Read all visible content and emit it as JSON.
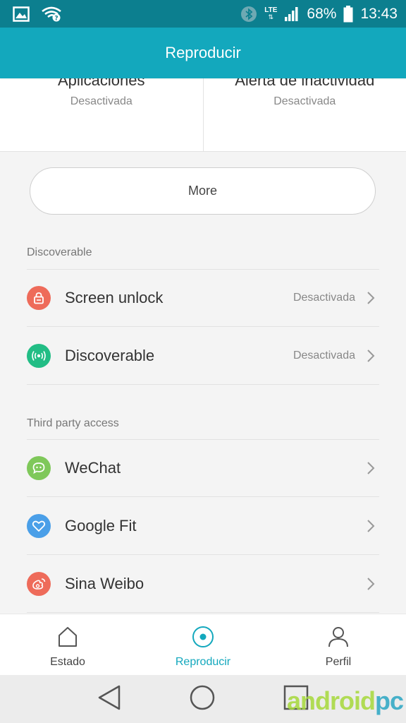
{
  "status_bar": {
    "network": "LTE",
    "battery": "68%",
    "time": "13:43"
  },
  "header": {
    "title": "Reproducir"
  },
  "top_cards": [
    {
      "title": "Aplicaciones",
      "value": "Desactivada"
    },
    {
      "title": "Alerta de inactividad",
      "value": "Desactivada"
    }
  ],
  "more_button": {
    "label": "More"
  },
  "sections": [
    {
      "header": "Discoverable",
      "items": [
        {
          "label": "Screen unlock",
          "value": "Desactivada",
          "icon": "lock-icon",
          "color": "#ee6b5a"
        },
        {
          "label": "Discoverable",
          "value": "Desactivada",
          "icon": "broadcast-icon",
          "color": "#22bd85"
        }
      ]
    },
    {
      "header": "Third party access",
      "items": [
        {
          "label": "WeChat",
          "icon": "wechat-icon",
          "color": "#7fc85a"
        },
        {
          "label": "Google Fit",
          "icon": "heart-icon",
          "color": "#4a9fe8"
        },
        {
          "label": "Sina Weibo",
          "icon": "weibo-icon",
          "color": "#ee6b5a"
        }
      ]
    }
  ],
  "bottom_nav": {
    "items": [
      {
        "label": "Estado",
        "icon": "home-icon"
      },
      {
        "label": "Reproducir",
        "icon": "target-icon",
        "active": true
      },
      {
        "label": "Perfil",
        "icon": "person-icon"
      }
    ]
  },
  "colors": {
    "status_bar": "#0c7f8f",
    "accent": "#13a8bd"
  },
  "watermark": {
    "main": "android",
    "suffix": "pc"
  }
}
